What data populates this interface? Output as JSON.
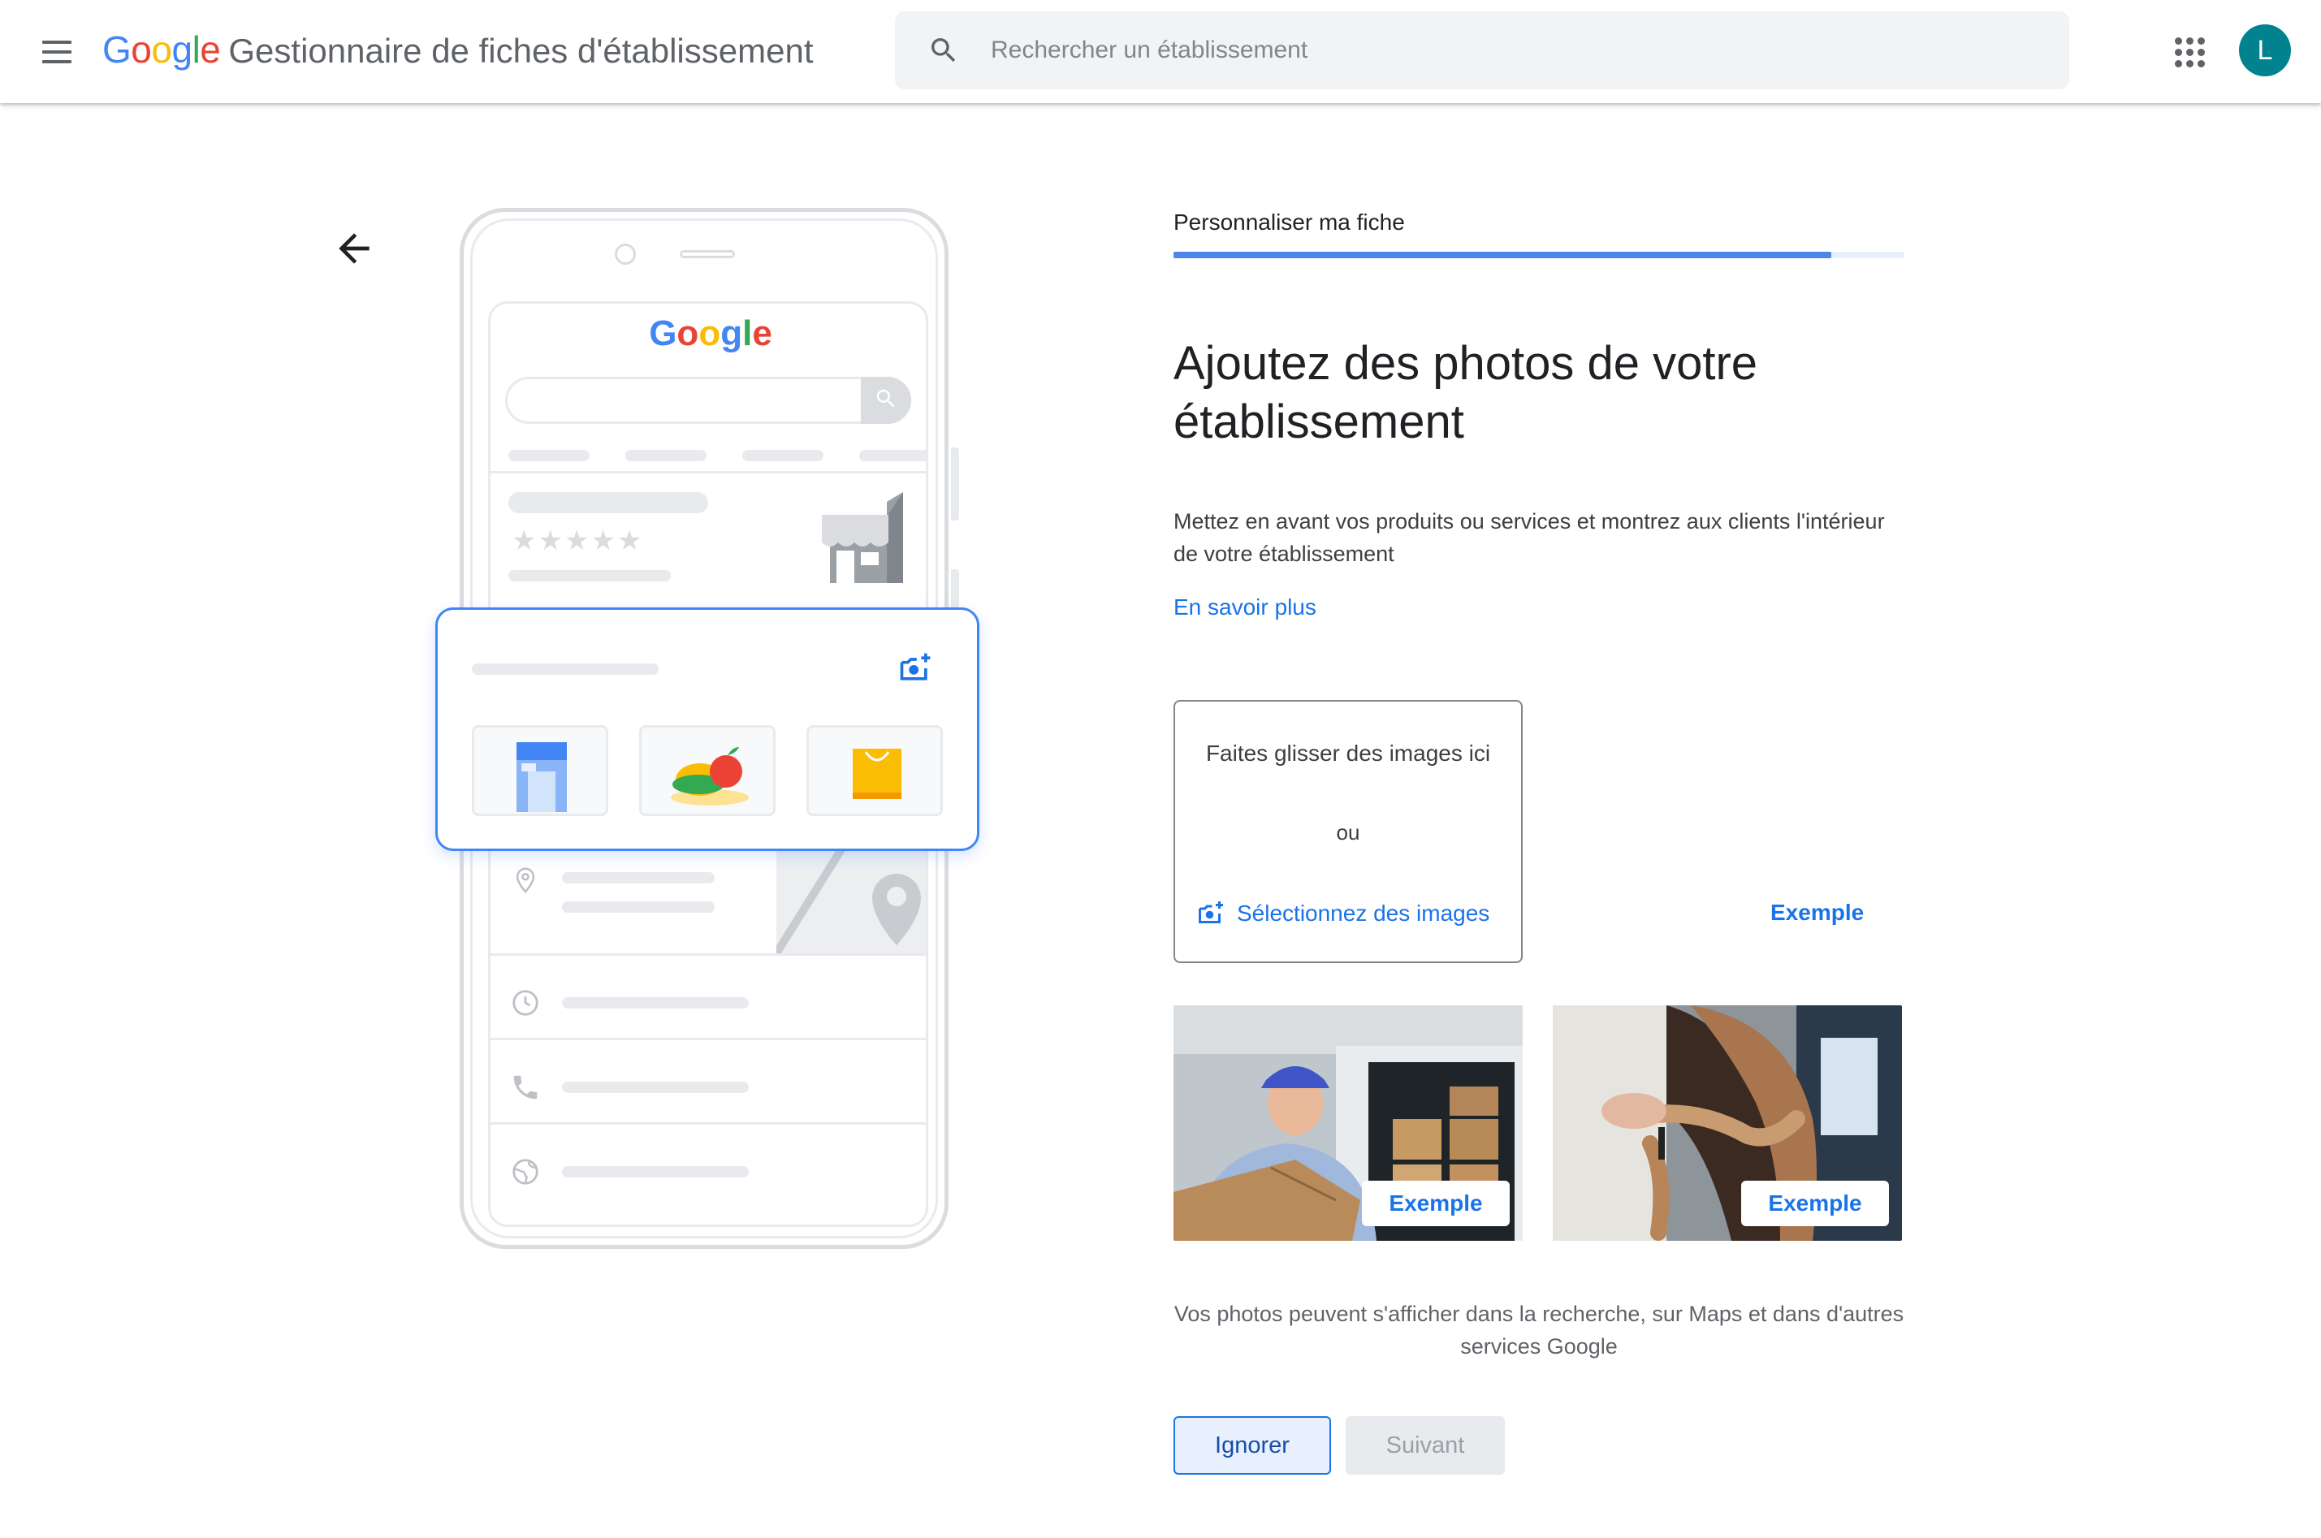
{
  "header": {
    "menu_icon": "hamburger-menu-icon",
    "brand_letters": [
      "G",
      "o",
      "o",
      "g",
      "l",
      "e"
    ],
    "product_name": "Gestionnaire de fiches d'établissement",
    "search_placeholder": "Rechercher un établissement",
    "apps_icon": "apps-grid-icon",
    "avatar_letter": "L",
    "avatar_color": "#00838f"
  },
  "illustration": {
    "screen_logo_letters": [
      "G",
      "o",
      "o",
      "g",
      "l",
      "e"
    ],
    "rating_stars": "★★★★★",
    "icons": [
      "storefront-icon",
      "add-photo-icon",
      "location-pin-icon",
      "map-pin-icon",
      "clock-icon",
      "phone-icon",
      "globe-icon",
      "building-icon",
      "produce-icon",
      "shopping-bag-icon"
    ]
  },
  "step": {
    "title": "Personnaliser ma fiche",
    "progress": 0.9,
    "accent_color": "#4d85e8"
  },
  "main": {
    "headline": "Ajoutez des photos de votre établissement",
    "description": "Mettez en avant vos produits ou services et montrez aux clients l'intérieur de votre établissement",
    "learn_more": "En savoir plus",
    "dropzone": {
      "drag_text": "Faites glisser des images ici",
      "or_text": "ou",
      "select_label": "Sélectionnez des images"
    },
    "example_label": "Exemple",
    "photos": [
      {
        "subject": "delivery-person-with-box",
        "label": "Exemple"
      },
      {
        "subject": "hairdresser-styling-hair",
        "label": "Exemple"
      }
    ],
    "note": "Vos photos peuvent s'afficher dans la recherche, sur Maps et dans d'autres services Google"
  },
  "actions": {
    "ignore_label": "Ignorer",
    "next_label": "Suivant",
    "next_disabled": true
  },
  "colors": {
    "link": "#1a73e8",
    "brand_blue": "#4285F4",
    "brand_red": "#EA4335",
    "brand_yellow": "#FBBC05",
    "brand_green": "#34A853"
  }
}
